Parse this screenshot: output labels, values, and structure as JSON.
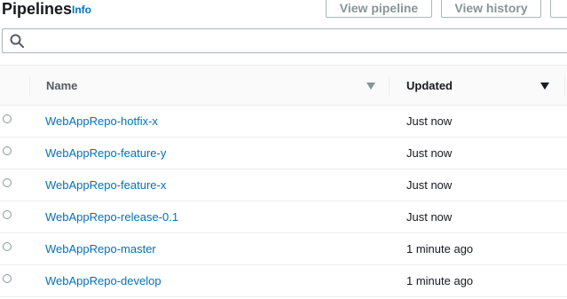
{
  "header": {
    "title": "Pipelines",
    "info_label": "Info",
    "buttons": {
      "view_pipeline": "View pipeline",
      "view_history": "View history"
    }
  },
  "search": {
    "value": "",
    "placeholder": ""
  },
  "table": {
    "columns": {
      "name": "Name",
      "updated": "Updated"
    },
    "rows": [
      {
        "name": "WebAppRepo-hotfix-x",
        "updated": "Just now"
      },
      {
        "name": "WebAppRepo-feature-y",
        "updated": "Just now"
      },
      {
        "name": "WebAppRepo-feature-x",
        "updated": "Just now"
      },
      {
        "name": "WebAppRepo-release-0.1",
        "updated": "Just now"
      },
      {
        "name": "WebAppRepo-master",
        "updated": "1 minute ago"
      },
      {
        "name": "WebAppRepo-develop",
        "updated": "1 minute ago"
      }
    ]
  },
  "colors": {
    "link": "#0073bb",
    "text": "#16191f",
    "muted": "#545b64",
    "disabled_button_text": "#879596",
    "border": "#eaeded"
  },
  "icons": {
    "search": "search-icon",
    "sort_name": "sort-caret-down-icon",
    "sort_updated": "sort-caret-down-icon"
  }
}
